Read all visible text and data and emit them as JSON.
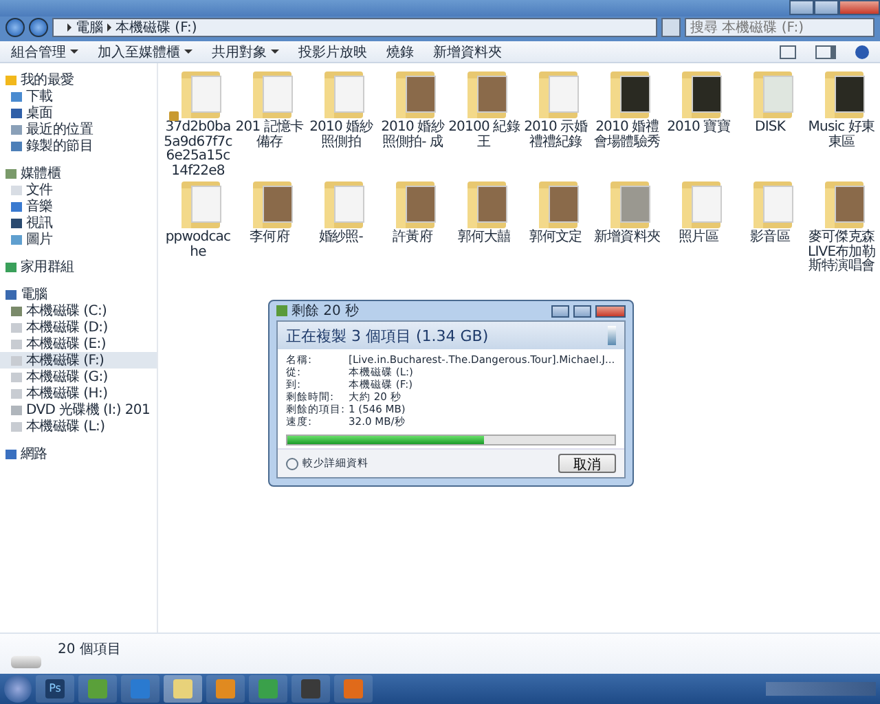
{
  "address": {
    "crumbs": [
      "電腦",
      "本機磁碟 (F:)"
    ]
  },
  "search": {
    "placeholder": "搜尋 本機磁碟 (F:)"
  },
  "toolbar": [
    {
      "label": "組合管理",
      "dropdown": true
    },
    {
      "label": "加入至媒體櫃",
      "dropdown": true
    },
    {
      "label": "共用對象",
      "dropdown": true
    },
    {
      "label": "投影片放映",
      "dropdown": false
    },
    {
      "label": "燒錄",
      "dropdown": false
    },
    {
      "label": "新增資料夾",
      "dropdown": false
    }
  ],
  "sidebar": [
    {
      "label": "我的最愛",
      "kind": "favorites",
      "children": [
        {
          "label": "下載",
          "kind": "download"
        },
        {
          "label": "桌面",
          "kind": "desktop"
        },
        {
          "label": "最近的位置",
          "kind": "recent"
        },
        {
          "label": "錄製的節目",
          "kind": "tv"
        }
      ]
    },
    {
      "label": "媒體櫃",
      "kind": "library",
      "children": [
        {
          "label": "文件",
          "kind": "doc"
        },
        {
          "label": "音樂",
          "kind": "music"
        },
        {
          "label": "視訊",
          "kind": "video"
        },
        {
          "label": "圖片",
          "kind": "picture"
        }
      ]
    },
    {
      "label": "家用群組",
      "kind": "homegroup"
    },
    {
      "label": "電腦",
      "kind": "computer",
      "children": [
        {
          "label": "本機磁碟 (C:)",
          "kind": "sysdrive",
          "selected": false
        },
        {
          "label": "本機磁碟 (D:)",
          "kind": "drive",
          "selected": false
        },
        {
          "label": "本機磁碟 (E:)",
          "kind": "drive",
          "selected": false
        },
        {
          "label": "本機磁碟 (F:)",
          "kind": "drive",
          "selected": true
        },
        {
          "label": "本機磁碟 (G:)",
          "kind": "drive",
          "selected": false
        },
        {
          "label": "本機磁碟 (H:)",
          "kind": "drive",
          "selected": false
        },
        {
          "label": "DVD 光碟機 (I:) 201",
          "kind": "dvd",
          "selected": false
        },
        {
          "label": "本機磁碟 (L:)",
          "kind": "drive",
          "selected": false
        }
      ]
    },
    {
      "label": "網路",
      "kind": "network"
    }
  ],
  "folders": [
    {
      "name": "37d2b0ba5a9d67f7c6e25a15c14f22e8",
      "kind": "paper",
      "locked": true
    },
    {
      "name": "201 記憶卡備存",
      "kind": "paper",
      "locked": false
    },
    {
      "name": "2010 婚紗照側拍",
      "kind": "paper",
      "locked": false
    },
    {
      "name": "2010 婚紗照側拍- 成",
      "kind": "photo",
      "locked": false
    },
    {
      "name": "20100 紀錄王",
      "kind": "photo",
      "locked": false
    },
    {
      "name": "2010 示婚禮禮紀錄",
      "kind": "paper",
      "locked": false
    },
    {
      "name": "2010 婚禮會場體驗秀",
      "kind": "dark",
      "locked": false
    },
    {
      "name": "2010 寶寶",
      "kind": "dark",
      "locked": false
    },
    {
      "name": "DISK",
      "kind": "disc",
      "locked": false
    },
    {
      "name": "Music 好東東區",
      "kind": "dark",
      "locked": false
    },
    {
      "name": "ppwodcache",
      "kind": "paper",
      "locked": false
    },
    {
      "name": "李何府",
      "kind": "photo",
      "locked": false
    },
    {
      "name": "婚紗照-",
      "kind": "paper",
      "locked": false
    },
    {
      "name": "許黃府",
      "kind": "photo",
      "locked": false
    },
    {
      "name": "郭何大囍",
      "kind": "photo",
      "locked": false
    },
    {
      "name": "郭何文定",
      "kind": "photo",
      "locked": false
    },
    {
      "name": "新增資料夾",
      "kind": "grey",
      "locked": false
    },
    {
      "name": "照片區",
      "kind": "paper",
      "locked": false
    },
    {
      "name": "影音區",
      "kind": "paper",
      "locked": false
    },
    {
      "name": "麥可傑克森 LIVE布加勒斯特演唱會",
      "kind": "photo",
      "locked": false
    }
  ],
  "status_bar": {
    "count": "20 個項目"
  },
  "dialog": {
    "title": "剩餘 20 秒",
    "heading": "正在複製 3 個項目 (1.34 GB)",
    "rows": [
      {
        "label": "名稱:",
        "value": "[Live.in.Bucharest-.The.Dangerous.Tour].Michael.J..."
      },
      {
        "label": "從:",
        "value": "本機磁碟 (L:)"
      },
      {
        "label": "到:",
        "value": "本機磁碟 (F:)"
      },
      {
        "label": "剩餘時間:",
        "value": "大約 20 秒"
      },
      {
        "label": "剩餘的項目:",
        "value": "1 (546 MB)"
      },
      {
        "label": "速度:",
        "value": "32.0 MB/秒"
      }
    ],
    "progress": {
      "level": 0.6
    },
    "details": "較少詳細資料",
    "cancel": "取消"
  },
  "taskbar": [
    {
      "kind": "ps",
      "label": "Ps",
      "active": false
    },
    {
      "kind": "media",
      "active": false
    },
    {
      "kind": "ie",
      "active": false
    },
    {
      "kind": "explorer",
      "active": true
    },
    {
      "kind": "player",
      "active": false
    },
    {
      "kind": "messenger",
      "active": false
    },
    {
      "kind": "photo",
      "active": false
    },
    {
      "kind": "firefox",
      "active": false
    }
  ]
}
